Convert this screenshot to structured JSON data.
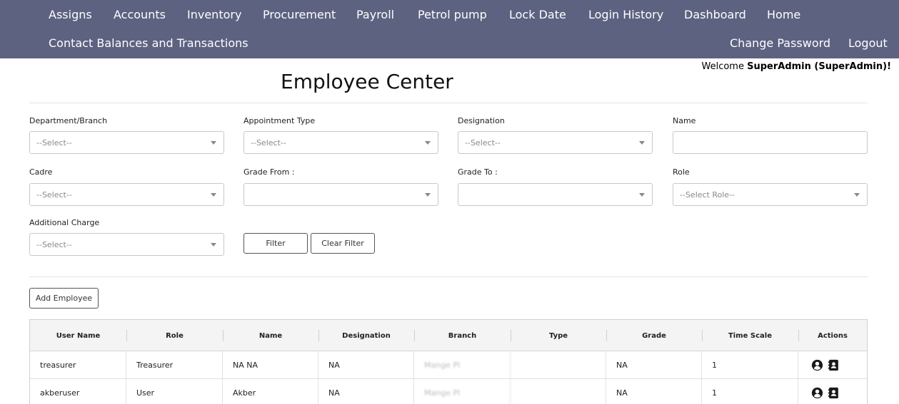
{
  "nav": {
    "row1": [
      "Assigns",
      "Accounts",
      "Inventory",
      "Procurement",
      "Payroll",
      "Petrol pump",
      "Lock Date",
      "Login History",
      "Dashboard",
      "Home"
    ],
    "row2_left": "Contact Balances and Transactions",
    "change_password": "Change Password",
    "logout": "Logout"
  },
  "welcome": {
    "prefix": "Welcome ",
    "user": "SuperAdmin (SuperAdmin)!"
  },
  "page_title": "Employee Center",
  "filters": {
    "department": {
      "label": "Department/Branch",
      "value": "--Select--"
    },
    "appointment_type": {
      "label": "Appointment Type",
      "value": "--Select--"
    },
    "designation": {
      "label": "Designation",
      "value": "--Select--"
    },
    "name": {
      "label": "Name",
      "value": ""
    },
    "cadre": {
      "label": "Cadre",
      "value": "--Select--"
    },
    "grade_from": {
      "label": "Grade From :",
      "value": ""
    },
    "grade_to": {
      "label": "Grade To :",
      "value": ""
    },
    "role": {
      "label": "Role",
      "value": "--Select Role--"
    },
    "additional_charge": {
      "label": "Additional Charge",
      "value": "--Select--"
    }
  },
  "buttons": {
    "filter": "Filter",
    "clear_filter": "Clear Filter",
    "add_employee": "Add Employee"
  },
  "table": {
    "columns": [
      "User Name",
      "Role",
      "Name",
      "Designation",
      "Branch",
      "Type",
      "Grade",
      "Time Scale",
      "Actions"
    ],
    "rows": [
      {
        "user_name": "treasurer",
        "role": "Treasurer",
        "name": "NA NA",
        "designation": "NA",
        "branch": "Mange Pl",
        "type": "",
        "grade": "NA",
        "time_scale": "1"
      },
      {
        "user_name": "akberuser",
        "role": "User",
        "name": "Akber",
        "designation": "NA",
        "branch": "Mange Pl",
        "type": "",
        "grade": "NA",
        "time_scale": "1"
      }
    ]
  },
  "icons": {
    "profile": "user-circle-icon",
    "contact": "contact-card-icon"
  },
  "colors": {
    "nav_bg": "#5d6281",
    "nav_text": "#ffffff"
  }
}
